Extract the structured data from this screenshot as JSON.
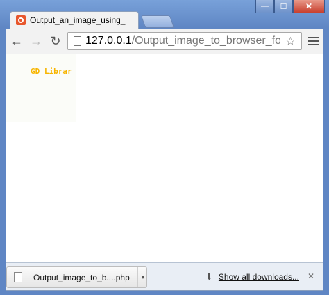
{
  "window": {
    "minimize": "—",
    "maximize": "☐",
    "close": "✕"
  },
  "tab": {
    "title": "Output_an_image_using_"
  },
  "toolbar": {
    "back": "←",
    "forward": "→",
    "reload": "↻",
    "url_host": "127.0.0.1",
    "url_path": "/Output_image_to_browser_for_",
    "star": "☆"
  },
  "content": {
    "gd_text": "GD Librar"
  },
  "downloads": {
    "file_name": "Output_image_to_b....php",
    "caret": "▼",
    "arrow": "⬇",
    "show_all": "Show all downloads...",
    "close": "✕"
  }
}
